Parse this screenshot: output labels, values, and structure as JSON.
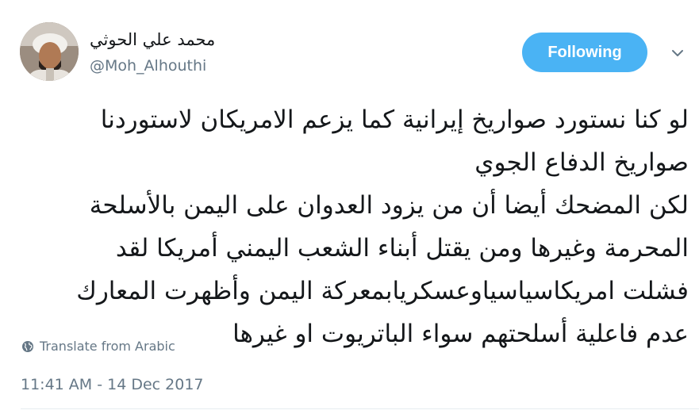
{
  "author": {
    "display_name": "محمد علي الحوثي",
    "handle": "@Moh_Alhouthi"
  },
  "follow_button": {
    "label": "Following",
    "color": "#4ab3f4"
  },
  "tweet": {
    "lines": [
      "لو كنا نستورد صواريخ إيرانية كما يزعم الامريكان لاستوردنا",
      "صواريخ الدفاع الجوي",
      "لكن المضحك أيضا أن من يزود العدوان على اليمن بالأسلحة",
      "المحرمة وغيرها ومن يقتل أبناء الشعب اليمني أمريكا لقد",
      "فشلت امريكاسياسياوعسكريابمعركة اليمن وأظهرت المعارك",
      "عدم فاعلية أسلحتهم سواء الباتريوت او غيرها"
    ]
  },
  "translate": {
    "label": "Translate from Arabic",
    "icon": "globe-icon"
  },
  "timestamp": "11:41 AM - 14 Dec 2017",
  "colors": {
    "text": "#14171a",
    "secondary": "#657786",
    "divider": "#e6ecf0"
  }
}
